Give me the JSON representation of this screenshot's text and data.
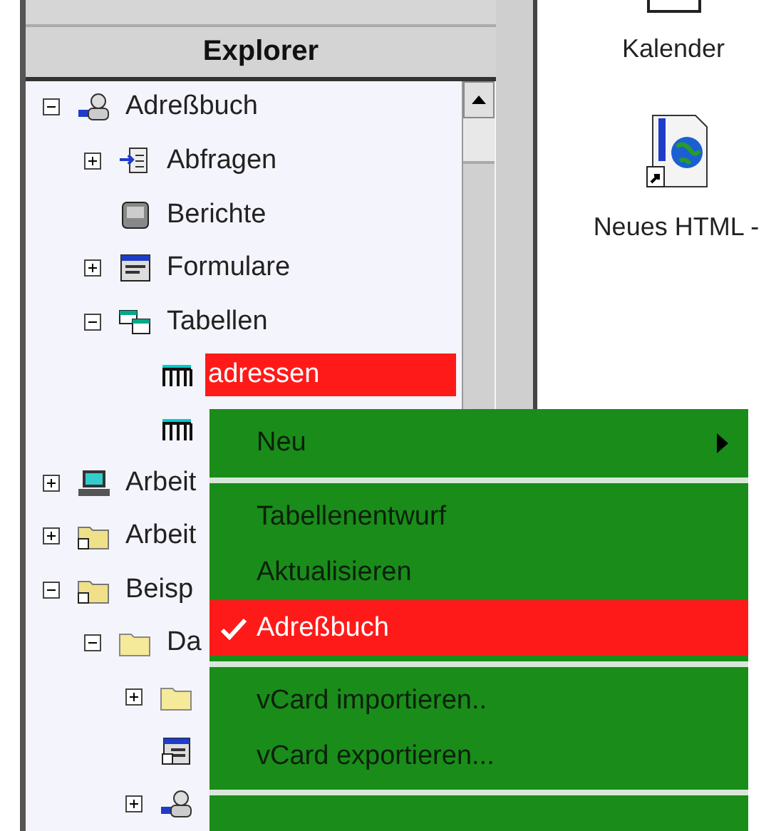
{
  "panel": {
    "title": "Explorer"
  },
  "tree": [
    {
      "label": "Adreßbuch",
      "kind": "addressbook",
      "expanded": true,
      "selected": false,
      "children": [
        {
          "label": "Abfragen",
          "kind": "query",
          "expanded": false,
          "selected": false
        },
        {
          "label": "Berichte",
          "kind": "report",
          "selected": false
        },
        {
          "label": "Formulare",
          "kind": "form",
          "expanded": false,
          "selected": false
        },
        {
          "label": "Tabellen",
          "kind": "tables",
          "expanded": true,
          "selected": false,
          "children": [
            {
              "label": "adressen",
              "kind": "table",
              "selected": true
            },
            {
              "kind": "table"
            }
          ]
        }
      ]
    },
    {
      "label": "Arbeit",
      "kind": "computer",
      "expanded": false,
      "selected": false
    },
    {
      "label": "Arbeit",
      "kind": "folder-link",
      "expanded": false,
      "selected": false
    },
    {
      "label": "Beisp",
      "kind": "folder-link",
      "expanded": true,
      "selected": false,
      "children": [
        {
          "label": "Da",
          "kind": "folder",
          "expanded": true,
          "selected": false,
          "children": [
            {
              "kind": "folder",
              "expanded": false
            },
            {
              "kind": "form-link"
            },
            {
              "kind": "addressbook",
              "expanded": false
            }
          ]
        }
      ]
    }
  ],
  "desktop_icons": [
    {
      "label": "Kalender",
      "kind": "calendar"
    },
    {
      "label": "Neues HTML -",
      "kind": "html"
    }
  ],
  "context_menu": [
    {
      "kind": "item",
      "label": "Neu",
      "submenu": true,
      "checked": false,
      "selected": false
    },
    {
      "kind": "separator"
    },
    {
      "kind": "item",
      "label": "Tabellenentwurf",
      "submenu": false,
      "checked": false,
      "selected": false
    },
    {
      "kind": "item",
      "label": "Aktualisieren",
      "submenu": false,
      "checked": false,
      "selected": false
    },
    {
      "kind": "item",
      "label": "Adreßbuch",
      "submenu": false,
      "checked": true,
      "selected": true
    },
    {
      "kind": "separator"
    },
    {
      "kind": "item",
      "label": "vCard importieren..",
      "submenu": false,
      "checked": false,
      "selected": false
    },
    {
      "kind": "item",
      "label": "vCard exportieren...",
      "submenu": false,
      "checked": false,
      "selected": false
    },
    {
      "kind": "separator"
    }
  ]
}
